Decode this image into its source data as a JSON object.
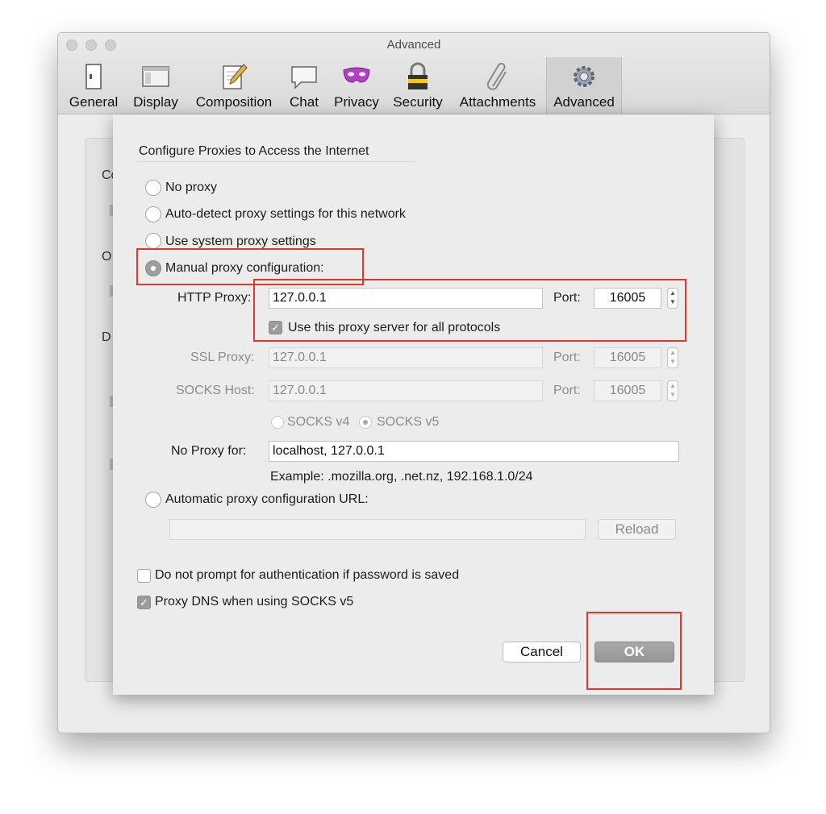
{
  "window": {
    "title": "Advanced"
  },
  "toolbar": {
    "tabs": [
      {
        "label": "General",
        "icon": "general-icon"
      },
      {
        "label": "Display",
        "icon": "display-icon"
      },
      {
        "label": "Composition",
        "icon": "composition-icon"
      },
      {
        "label": "Chat",
        "icon": "chat-icon"
      },
      {
        "label": "Privacy",
        "icon": "privacy-icon"
      },
      {
        "label": "Security",
        "icon": "security-icon"
      },
      {
        "label": "Attachments",
        "icon": "attachments-icon"
      },
      {
        "label": "Advanced",
        "icon": "advanced-icon",
        "selected": true
      }
    ]
  },
  "background": {
    "letters": [
      "Co",
      "O",
      "D"
    ]
  },
  "dialog": {
    "heading": "Configure Proxies to Access the Internet",
    "options": {
      "no_proxy": "No proxy",
      "auto_detect": "Auto-detect proxy settings for this network",
      "system": "Use system proxy settings",
      "manual": "Manual proxy configuration:",
      "auto_url": "Automatic proxy configuration URL:"
    },
    "selected_option": "manual",
    "http": {
      "label": "HTTP Proxy:",
      "value": "127.0.0.1",
      "port_label": "Port:",
      "port": "16005"
    },
    "use_for_all": {
      "label": "Use this proxy server for all protocols",
      "checked": true
    },
    "ssl": {
      "label": "SSL Proxy:",
      "value": "127.0.0.1",
      "port_label": "Port:",
      "port": "16005"
    },
    "socks": {
      "label": "SOCKS Host:",
      "value": "127.0.0.1",
      "port_label": "Port:",
      "port": "16005"
    },
    "socks_v4": "SOCKS v4",
    "socks_v5": "SOCKS v5",
    "no_proxy_for": {
      "label": "No Proxy for:",
      "value": "localhost, 127.0.0.1"
    },
    "example": "Example: .mozilla.org, .net.nz, 192.168.1.0/24",
    "auto_url_value": "",
    "reload": "Reload",
    "no_auth_prompt": {
      "label": "Do not prompt for authentication if password is saved",
      "checked": false
    },
    "proxy_dns": {
      "label": "Proxy DNS when using SOCKS v5",
      "checked": true
    },
    "cancel": "Cancel",
    "ok": "OK"
  },
  "colors": {
    "annotation": "#e0382b",
    "selected_control": "#9e9e9e"
  }
}
